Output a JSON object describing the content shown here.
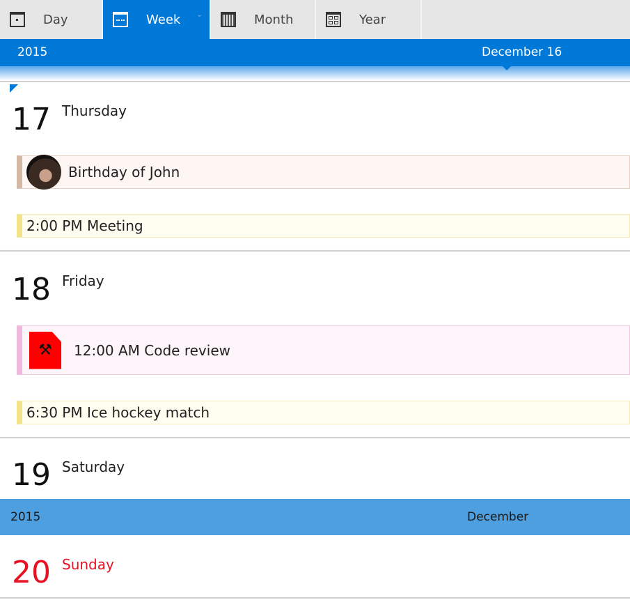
{
  "tabs": [
    {
      "label": "Day",
      "icon": "day-calendar-icon"
    },
    {
      "label": "Week",
      "icon": "week-calendar-icon",
      "active": true
    },
    {
      "label": "Month",
      "icon": "month-calendar-icon"
    },
    {
      "label": "Year",
      "icon": "year-calendar-icon"
    }
  ],
  "header": {
    "year": "2015",
    "date": "December 16",
    "partial_day": "16"
  },
  "days": [
    {
      "number": "17",
      "name": "Thursday",
      "events": [
        {
          "title": "Birthday of John",
          "icon": "avatar-chimp"
        },
        {
          "title": "2:00 PM Meeting"
        }
      ]
    },
    {
      "number": "18",
      "name": "Friday",
      "events": [
        {
          "title": "12:00 AM Code review",
          "icon": "red-document-hammer-icon"
        },
        {
          "title": "6:30 PM Ice hockey match"
        }
      ]
    },
    {
      "number": "19",
      "name": "Saturday",
      "events": []
    },
    {
      "number": "20",
      "name": "Sunday",
      "events": [],
      "color": "#e81123"
    }
  ],
  "month_header": {
    "year": "2015",
    "month": "December"
  },
  "colors": {
    "accent": "#0078d7",
    "month_bar": "#4d9fe0",
    "sunday": "#e81123"
  }
}
